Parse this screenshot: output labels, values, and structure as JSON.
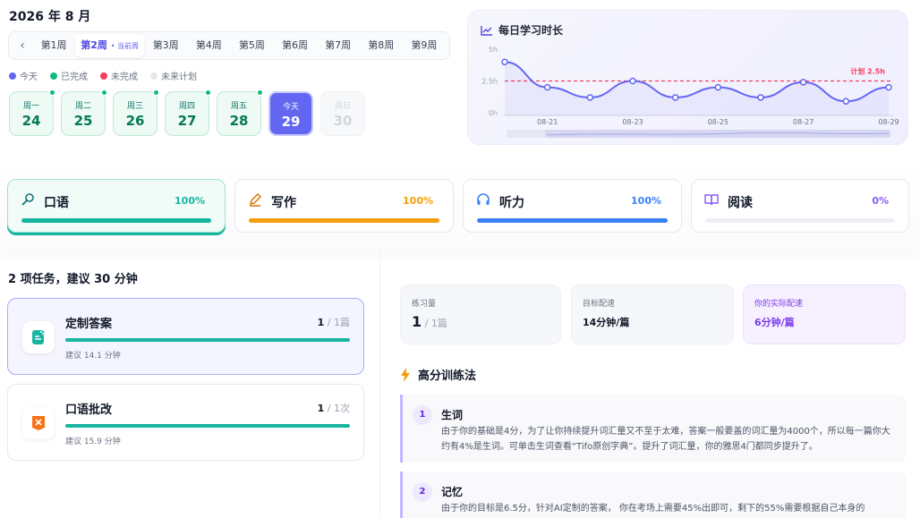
{
  "header": {
    "month": "2026 年 8 月"
  },
  "weeks": {
    "prev_icon": "chevron-left-icon",
    "tabs": [
      "第1周",
      "第2周",
      "第3周",
      "第4周",
      "第5周",
      "第6周",
      "第7周",
      "第8周",
      "第9周"
    ],
    "active_index": 1,
    "current_label": "• 当前周"
  },
  "legend": [
    {
      "label": "今天",
      "color": "#6366f1"
    },
    {
      "label": "已完成",
      "color": "#10b981"
    },
    {
      "label": "未完成",
      "color": "#f43f5e"
    },
    {
      "label": "未来计划",
      "color": "#e5e7eb"
    }
  ],
  "days": [
    {
      "name": "周一",
      "date": "24",
      "state": "done"
    },
    {
      "name": "周二",
      "date": "25",
      "state": "done"
    },
    {
      "name": "周三",
      "date": "26",
      "state": "done"
    },
    {
      "name": "周四",
      "date": "27",
      "state": "done"
    },
    {
      "name": "周五",
      "date": "28",
      "state": "done"
    },
    {
      "name": "今天",
      "date": "29",
      "state": "today"
    },
    {
      "name": "周日",
      "date": "30",
      "state": "future"
    }
  ],
  "chart_data": {
    "type": "line",
    "title": "每日学习时长",
    "x": [
      "08-20",
      "08-21",
      "08-22",
      "08-23",
      "08-24",
      "08-25",
      "08-26",
      "08-27",
      "08-28",
      "08-29"
    ],
    "x_tick_labels": [
      "08-21",
      "08-23",
      "08-25",
      "08-27",
      "08-29"
    ],
    "series": [
      {
        "values": [
          4.0,
          2.0,
          1.2,
          2.5,
          1.2,
          2.0,
          1.2,
          2.4,
          0.9,
          2.0
        ]
      }
    ],
    "y_ticks": [
      "0h",
      "2.5h",
      "5h"
    ],
    "ylim": [
      0,
      5
    ],
    "plan": {
      "value": 2.5,
      "label": "计划 2.5h"
    },
    "grid": false,
    "colors": {
      "line": "#6366f1",
      "plan": "#f43f5e"
    }
  },
  "subjects": [
    {
      "name": "口语",
      "percent": "100%",
      "fill": 1.0,
      "color": "#17b5a0",
      "icon": "microphone-icon",
      "active": true
    },
    {
      "name": "写作",
      "percent": "100%",
      "fill": 1.0,
      "color": "#f59e0b",
      "icon": "pencil-icon",
      "active": false
    },
    {
      "name": "听力",
      "percent": "100%",
      "fill": 1.0,
      "color": "#3b82f6",
      "icon": "headphones-icon",
      "active": false
    },
    {
      "name": "阅读",
      "percent": "0%",
      "fill": 0.0,
      "color": "#8b5cf6",
      "icon": "book-icon",
      "active": false
    }
  ],
  "tasks": {
    "title": "2 项任务，建议 30 分钟",
    "items": [
      {
        "name": "定制答案",
        "done": "1",
        "total": " / 1篇",
        "hint": "建议 14.1 分钟",
        "icon": "document-icon"
      },
      {
        "name": "口语批改",
        "done": "1",
        "total": " / 1次",
        "hint": "建议 15.9 分钟",
        "icon": "flag-icon"
      }
    ]
  },
  "stats": [
    {
      "label": "练习量",
      "big": "1",
      "sub": " / 1篇"
    },
    {
      "label": "目标配速",
      "value": "14分钟/篇"
    },
    {
      "label": "你的实际配速",
      "value": "6分钟/篇"
    }
  ],
  "methods": {
    "title": "高分训练法",
    "items": [
      {
        "num": "1",
        "name": "生词",
        "desc": "由于你的基础是4分，为了让你持续提升词汇量又不至于太难，答案一般要盖的词汇量为4000个，所以每一篇你大约有4%是生词。可单击生词查看“Tifo原创字典”。提升了词汇量，你的雅思4门都同步提升了。"
      },
      {
        "num": "2",
        "name": "记忆",
        "desc": "由于你的目标是6.5分，针对AI定制的答案， 你在考场上需要45%出即可，剩下的55%需要根据自己本身的"
      }
    ]
  }
}
